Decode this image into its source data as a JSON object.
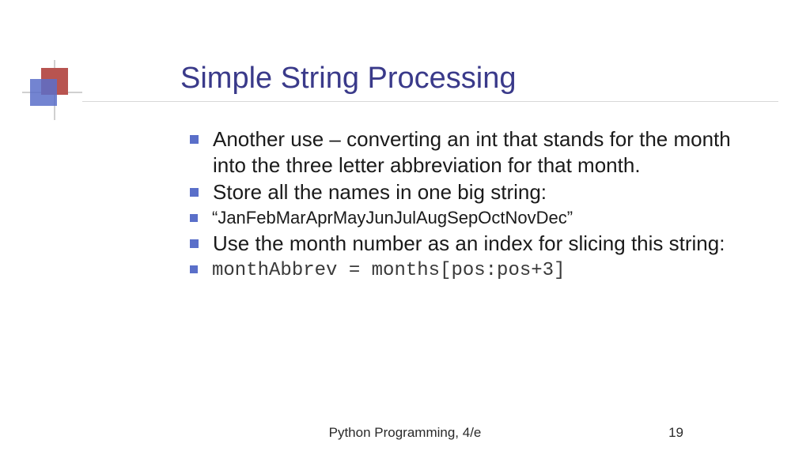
{
  "title": "Simple String Processing",
  "bullets": [
    {
      "text": "Another use – converting an int that stands for the month into the three letter abbreviation for that month.",
      "size": "large"
    },
    {
      "text": "Store all the names in one big string:",
      "size": "large"
    },
    {
      "text": "“JanFebMarAprMayJunJulAugSepOctNovDec”",
      "size": "small"
    },
    {
      "text": "Use the month number as an index for slicing this string:",
      "size": "large"
    },
    {
      "text": "monthAbbrev = months[pos:pos+3]",
      "size": "code"
    }
  ],
  "footer": {
    "text": "Python Programming, 4/e",
    "page": "19"
  }
}
